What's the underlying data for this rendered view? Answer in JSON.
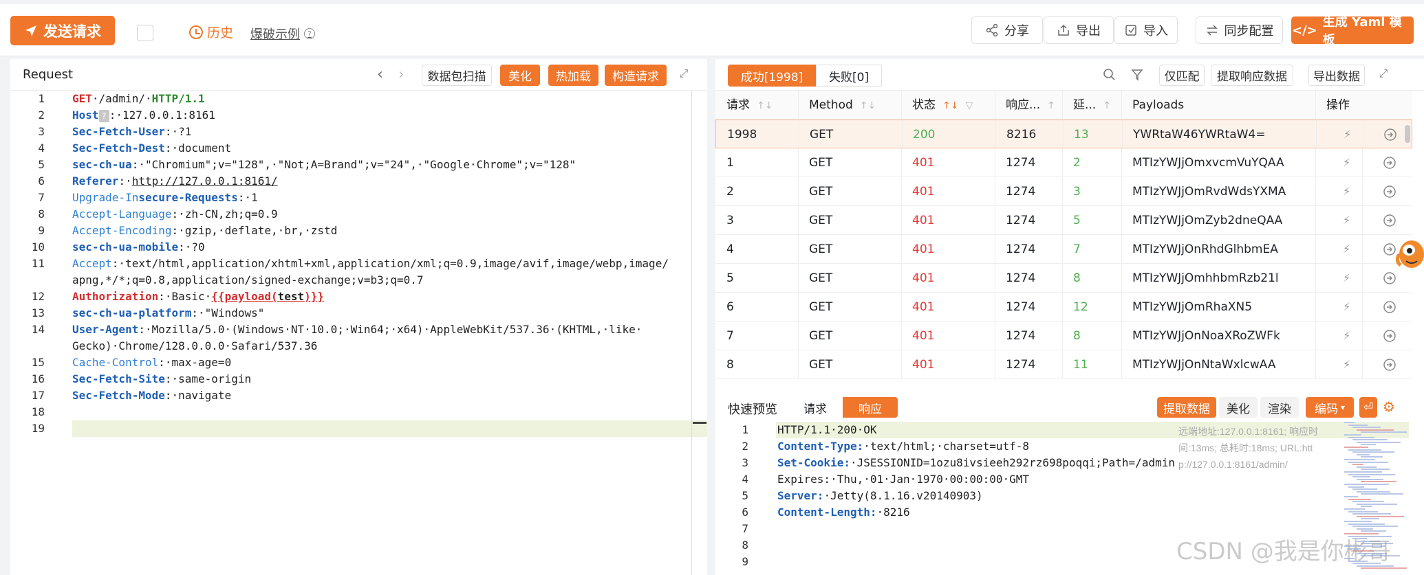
{
  "toolbar": {
    "send_label": "发送请求",
    "history_label": "历史",
    "example_label": "爆破示例",
    "share_label": "分享",
    "export_label": "导出",
    "import_label": "导入",
    "sync_label": "同步配置",
    "yaml_label": "生成 Yaml 模板"
  },
  "request_panel": {
    "title": "Request",
    "scan_label": "数据包扫描",
    "beautify_label": "美化",
    "hotload_label": "热加载",
    "build_label": "构造请求",
    "lines": [
      {
        "n": "1"
      },
      {
        "n": "2"
      },
      {
        "n": "3"
      },
      {
        "n": "4"
      },
      {
        "n": "5"
      },
      {
        "n": "6"
      },
      {
        "n": "7"
      },
      {
        "n": "8"
      },
      {
        "n": "9"
      },
      {
        "n": "10"
      },
      {
        "n": "11"
      },
      {
        "n": "12"
      },
      {
        "n": "13"
      },
      {
        "n": "14"
      },
      {
        "n": "15"
      },
      {
        "n": "16"
      },
      {
        "n": "17"
      },
      {
        "n": "18"
      },
      {
        "n": "19"
      }
    ]
  },
  "results_panel": {
    "tab_success": "成功[1998]",
    "tab_fail": "失败[0]",
    "only_match": "仅匹配",
    "extract_resp": "提取响应数据",
    "export_data": "导出数据",
    "columns": [
      "请求",
      "Method",
      "状态",
      "响应...",
      "延...",
      "Payloads",
      "操作"
    ],
    "rows": [
      {
        "id": "1998",
        "method": "GET",
        "status": "200",
        "size": "8216",
        "delay": "13",
        "payload": "YWRtaW46YWRtaW4="
      },
      {
        "id": "1",
        "method": "GET",
        "status": "401",
        "size": "1274",
        "delay": "2",
        "payload": "MTIzYWJjOmxvcmVuYQAA"
      },
      {
        "id": "2",
        "method": "GET",
        "status": "401",
        "size": "1274",
        "delay": "3",
        "payload": "MTIzYWJjOmRvdWdsYXMA"
      },
      {
        "id": "3",
        "method": "GET",
        "status": "401",
        "size": "1274",
        "delay": "5",
        "payload": "MTIzYWJjOmZyb2dneQAA"
      },
      {
        "id": "4",
        "method": "GET",
        "status": "401",
        "size": "1274",
        "delay": "7",
        "payload": "MTIzYWJjOnRhdGlhbmEA"
      },
      {
        "id": "5",
        "method": "GET",
        "status": "401",
        "size": "1274",
        "delay": "8",
        "payload": "MTIzYWJjOmhhbmRzb21l"
      },
      {
        "id": "6",
        "method": "GET",
        "status": "401",
        "size": "1274",
        "delay": "12",
        "payload": "MTIzYWJjOmRhaXN5"
      },
      {
        "id": "7",
        "method": "GET",
        "status": "401",
        "size": "1274",
        "delay": "8",
        "payload": "MTIzYWJjOnNoaXRoZWFk"
      },
      {
        "id": "8",
        "method": "GET",
        "status": "401",
        "size": "1274",
        "delay": "11",
        "payload": "MTIzYWJjOnNtaWxlcwAA"
      }
    ]
  },
  "preview": {
    "title": "快速预览",
    "tab_request": "请求",
    "tab_response": "响应",
    "extract_label": "提取数据",
    "beautify_label": "美化",
    "render_label": "渲染",
    "encode_label": "编码",
    "meta_line1": "远端地址:127.0.0.1:8161; 响应时",
    "meta_line2": "间:13ms; 总耗时:18ms; URL:htt",
    "meta_line3": "p://127.0.0.1:8161/admin/",
    "lines": [
      {
        "n": "1",
        "plain": "HTTP/1.1·200·OK"
      },
      {
        "n": "2",
        "key": "Content-Type:",
        "val": "·text/html;·charset=utf-8"
      },
      {
        "n": "3",
        "key": "Set-Cookie:",
        "val": "·JSESSIONID=1ozu8ivsieeh292rz698poqqi;Path=/admin"
      },
      {
        "n": "4",
        "plain": "Expires:·Thu,·01·Jan·1970·00:00:00·GMT"
      },
      {
        "n": "5",
        "key": "Server:",
        "val": "·Jetty(8.1.16.v20140903)"
      },
      {
        "n": "6",
        "key": "Content-Length:",
        "val": "·8216"
      },
      {
        "n": "7"
      },
      {
        "n": "8"
      },
      {
        "n": "9"
      }
    ]
  },
  "watermark": "CSDN @我是你彬哥",
  "colors": {
    "accent": "#f0762b",
    "success": "#4caf50",
    "error": "#e53935",
    "key_blue": "#1e5fb4"
  }
}
